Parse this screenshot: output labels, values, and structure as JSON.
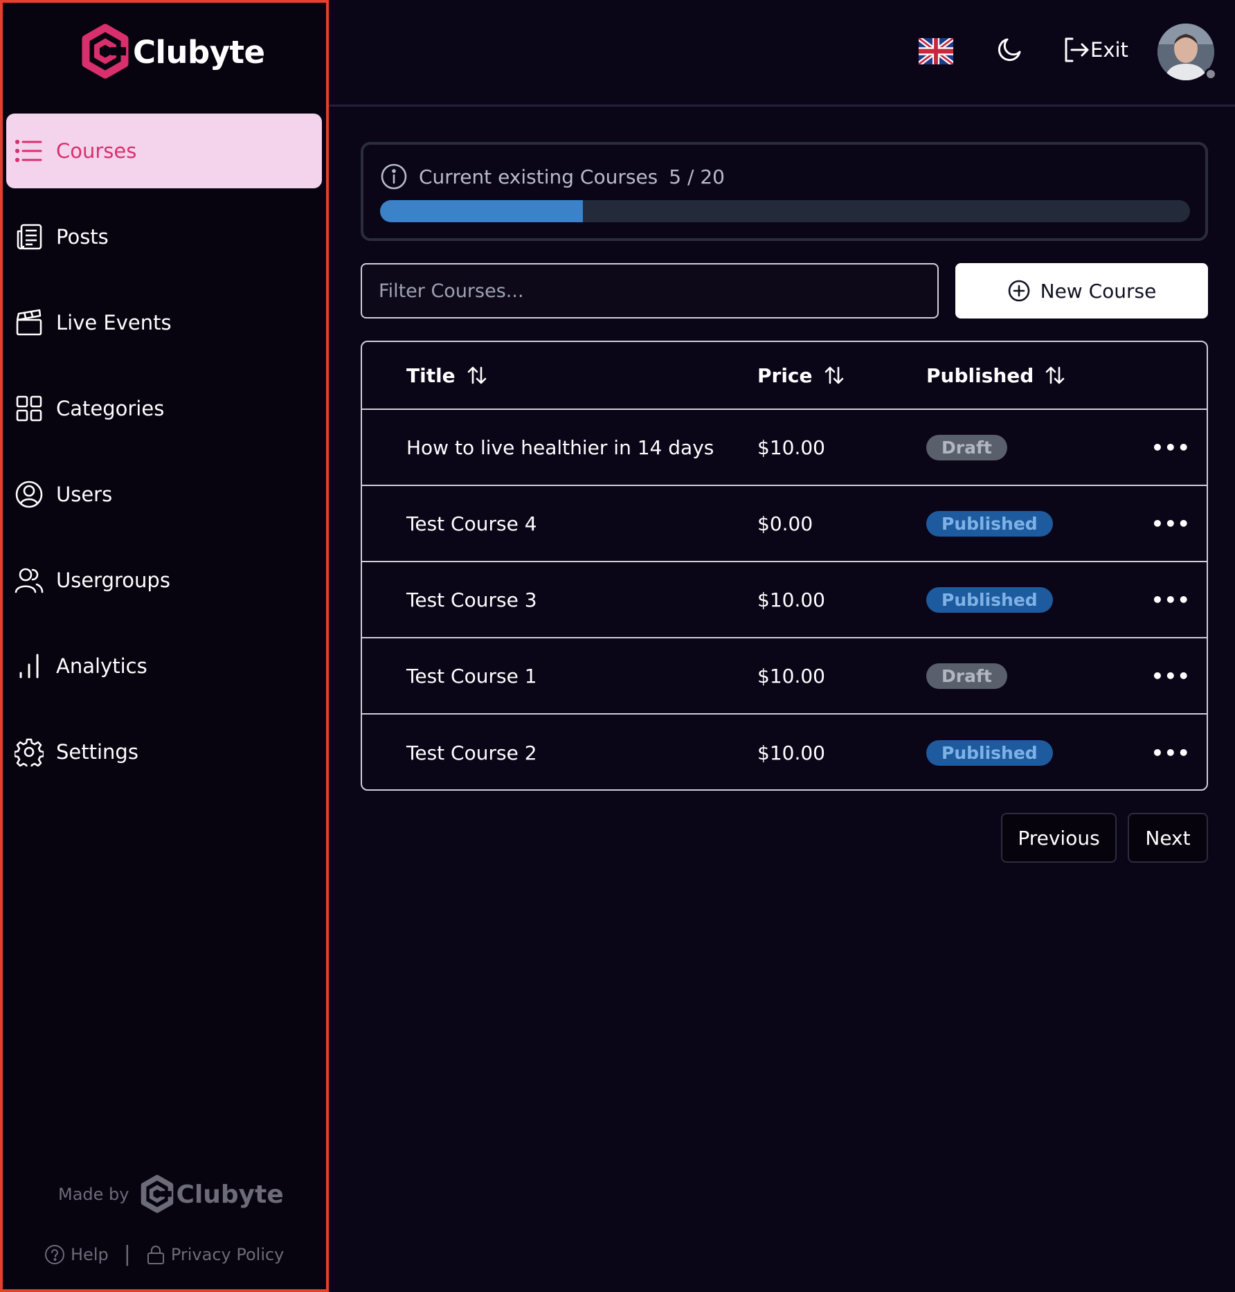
{
  "brand": {
    "name": "Clubyte",
    "accent": "#d9306d"
  },
  "sidebar": {
    "items": [
      {
        "label": "Courses",
        "icon": "list-icon",
        "active": true
      },
      {
        "label": "Posts",
        "icon": "newspaper-icon",
        "active": false
      },
      {
        "label": "Live Events",
        "icon": "clapperboard-icon",
        "active": false
      },
      {
        "label": "Categories",
        "icon": "grid-icon",
        "active": false
      },
      {
        "label": "Users",
        "icon": "user-circle-icon",
        "active": false
      },
      {
        "label": "Usergroups",
        "icon": "users-icon",
        "active": false
      },
      {
        "label": "Analytics",
        "icon": "bar-chart-icon",
        "active": false
      },
      {
        "label": "Settings",
        "icon": "gear-icon",
        "active": false
      }
    ],
    "made_by": "Made by",
    "made_by_brand": "Clubyte",
    "help": "Help",
    "separator": "|",
    "privacy": "Privacy Policy"
  },
  "header": {
    "language_icon": "uk-flag-icon",
    "theme_icon": "moon-icon",
    "exit_label": "Exit"
  },
  "course_quota": {
    "label": "Current existing Courses",
    "count_text": "5 / 20",
    "current": 5,
    "max": 20,
    "bar_color": "#3b82c9"
  },
  "filter": {
    "placeholder": "Filter Courses..."
  },
  "new_course_label": "New Course",
  "table": {
    "headers": {
      "title": "Title",
      "price": "Price",
      "published": "Published"
    },
    "rows": [
      {
        "title": "How to live healthier in 14 days",
        "price": "$10.00",
        "status": "Draft"
      },
      {
        "title": "Test Course 4",
        "price": "$0.00",
        "status": "Published"
      },
      {
        "title": "Test Course 3",
        "price": "$10.00",
        "status": "Published"
      },
      {
        "title": "Test Course 1",
        "price": "$10.00",
        "status": "Draft"
      },
      {
        "title": "Test Course 2",
        "price": "$10.00",
        "status": "Published"
      }
    ],
    "actions_glyph": "•••"
  },
  "pagination": {
    "previous": "Previous",
    "next": "Next"
  }
}
